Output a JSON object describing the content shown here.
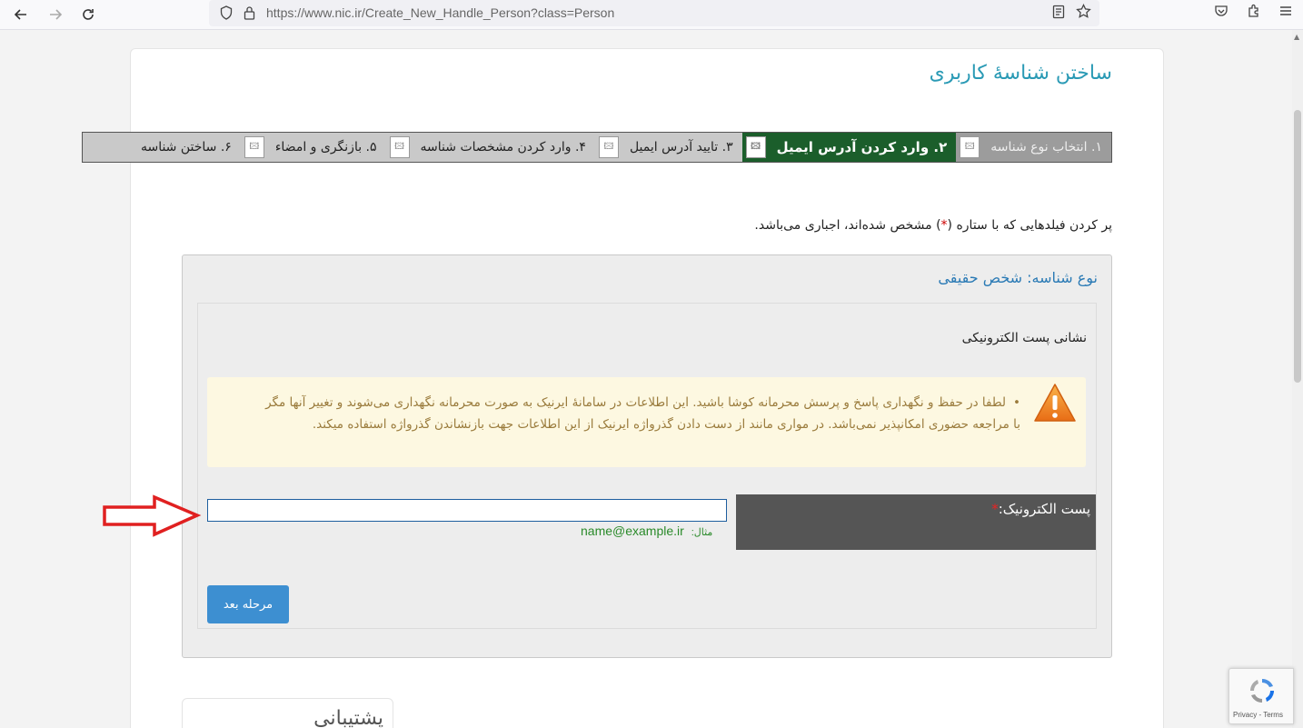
{
  "browser": {
    "url": "https://www.nic.ir/Create_New_Handle_Person?class=Person"
  },
  "page": {
    "title": "ساختن شناسهٔ کاربری",
    "steps": [
      {
        "label": "۱.   انتخاب نوع شناسه",
        "state": "done"
      },
      {
        "label": "۲.  وارد کردن آدرس ایمیل",
        "state": "active"
      },
      {
        "label": "۳.   تایید آدرس ایمیل",
        "state": "pending"
      },
      {
        "label": "۴.   وارد کردن مشخصات شناسه",
        "state": "pending"
      },
      {
        "label": "۵.   بازنگری و امضاء",
        "state": "pending"
      },
      {
        "label": "۶.   ساختن شناسه",
        "state": "pending"
      }
    ],
    "required_note_before": "پر کردن فیلدهایی که با ستاره (",
    "required_note_star": "*",
    "required_note_after": ") مشخص شده‌اند، اجباری می‌باشد."
  },
  "form": {
    "panel_title": "نوع شناسه: شخص حقیقی",
    "section_title": "نشانی پست الکترونیکی",
    "warning": "لطفا در حفظ و نگهداری پاسخ و پرسش محرمانه کوشا باشید. این اطلاعات در سامانهٔ ایرنیک به صورت محرمانه نگهداری می‌شوند و تغییر آنها مگر با مراجعه حضوری امکانپذیر نمی‌باشد. در مواری مانند از دست دادن گذرواژه ایرنیک از این اطلاعات جهت بازنشاندن گذرواژه استفاده میکند.",
    "email_label": "پست الکترونیک:",
    "email_star": "*",
    "email_value": "",
    "example_prefix": "مثال:",
    "example_value": "name@example.ir",
    "next_button": "مرحله بعد"
  },
  "support": {
    "title": "پشتیبانی"
  },
  "recaptcha": {
    "text": "Privacy - Terms"
  },
  "colors": {
    "title": "#2a9ab5",
    "active_step": "#1b5e2b",
    "button": "#3d8fd1",
    "warning_bg": "#fdf8e1",
    "arrow": "#e02020"
  }
}
